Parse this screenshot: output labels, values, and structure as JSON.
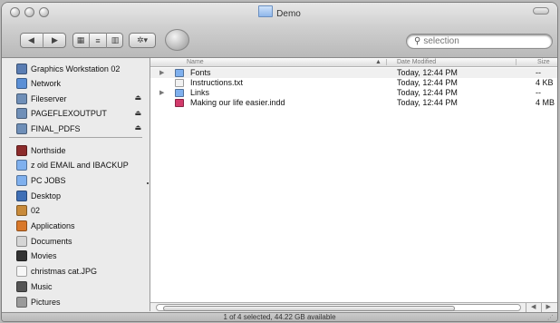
{
  "window": {
    "title": "Demo"
  },
  "toolbar": {
    "back_glyph": "◀",
    "forward_glyph": "▶",
    "view_icons": [
      "▦",
      "≡",
      "▥"
    ],
    "action_glyph": "✲▾",
    "search": {
      "placeholder": "selection",
      "icon": "search-icon"
    }
  },
  "sidebar": {
    "devices": [
      {
        "label": "Graphics Workstation 02",
        "icon": "computer-icon",
        "color": "#5a7db3",
        "eject": false
      },
      {
        "label": "Network",
        "icon": "globe-icon",
        "color": "#5a8fd6",
        "eject": false
      },
      {
        "label": "Fileserver",
        "icon": "server-icon",
        "color": "#6f8fb8",
        "eject": true
      },
      {
        "label": "PAGEFLEXOUTPUT",
        "icon": "server-icon",
        "color": "#6f8fb8",
        "eject": true
      },
      {
        "label": "FINAL_PDFS",
        "icon": "server-icon",
        "color": "#6f8fb8",
        "eject": true
      }
    ],
    "places": [
      {
        "label": "Northside",
        "icon": "briefcase-icon",
        "color": "#8c2b2b"
      },
      {
        "label": "z old EMAIL and IBACKUP",
        "icon": "folder-icon",
        "color": "#7fb0ee"
      },
      {
        "label": "PC JOBS",
        "icon": "folder-icon",
        "color": "#7fb0ee"
      },
      {
        "label": "Desktop",
        "icon": "desktop-icon",
        "color": "#3f6fb6"
      },
      {
        "label": "02",
        "icon": "home-icon",
        "color": "#c88a3a"
      },
      {
        "label": "Applications",
        "icon": "applications-icon",
        "color": "#d9782a"
      },
      {
        "label": "Documents",
        "icon": "documents-icon",
        "color": "#d5d5d5"
      },
      {
        "label": "Movies",
        "icon": "movies-icon",
        "color": "#333333"
      },
      {
        "label": "christmas cat.JPG",
        "icon": "image-file-icon",
        "color": "#f7f7f7"
      },
      {
        "label": "Music",
        "icon": "music-icon",
        "color": "#555555"
      },
      {
        "label": "Pictures",
        "icon": "pictures-icon",
        "color": "#9a9a9a"
      }
    ],
    "eject_glyph": "⏏"
  },
  "list": {
    "columns": {
      "name": "Name",
      "date": "Date Modified",
      "size": "Size"
    },
    "sort_glyph": "▲",
    "rows": [
      {
        "name": "Fonts",
        "date": "Today, 12:44 PM",
        "size": "--",
        "icon": "folder-icon",
        "color": "#7fb0ee",
        "expandable": true
      },
      {
        "name": "Instructions.txt",
        "date": "Today, 12:44 PM",
        "size": "4 KB",
        "icon": "text-file-icon",
        "color": "#f1f1f1",
        "expandable": false
      },
      {
        "name": "Links",
        "date": "Today, 12:44 PM",
        "size": "--",
        "icon": "folder-icon",
        "color": "#7fb0ee",
        "expandable": true
      },
      {
        "name": "Making our life easier.indd",
        "date": "Today, 12:44 PM",
        "size": "4 MB",
        "icon": "indesign-file-icon",
        "color": "#d23a6b",
        "expandable": false
      }
    ],
    "expand_glyph": "▶"
  },
  "scrollbar": {
    "left_glyph": "◀",
    "right_glyph": "▶"
  },
  "status": {
    "text": "1 of 4 selected, 44.22 GB available",
    "grip": "⋰"
  }
}
